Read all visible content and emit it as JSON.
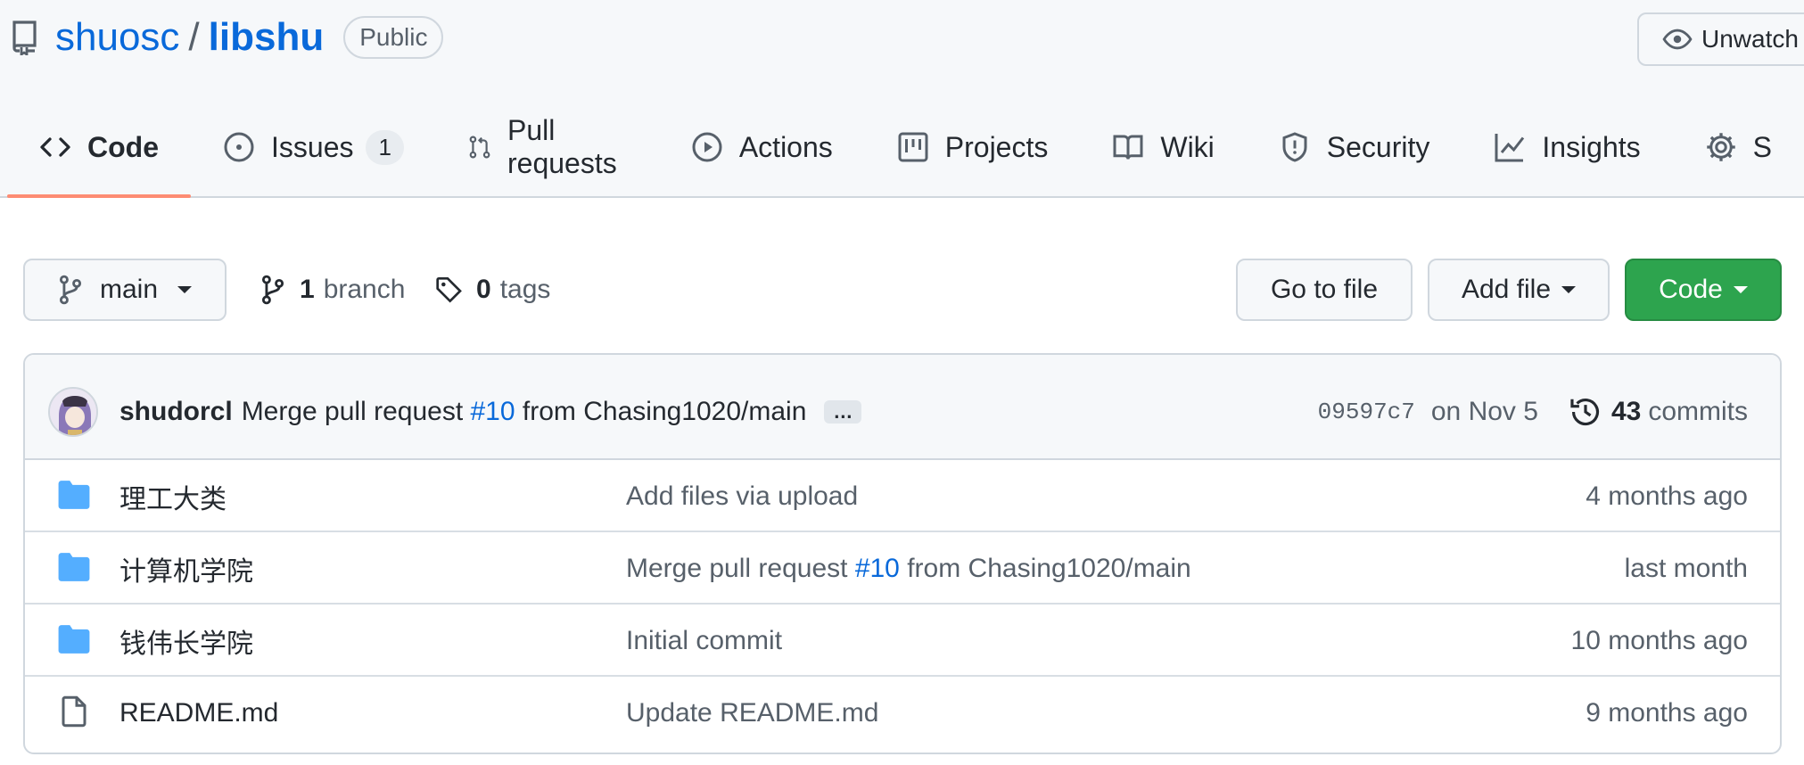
{
  "repo": {
    "owner": "shuosc",
    "separator": "/",
    "name": "libshu",
    "visibility": "Public"
  },
  "header_actions": {
    "watch_label": "Unwatch"
  },
  "tabs": [
    {
      "label": "Code",
      "icon": "code-icon",
      "selected": true
    },
    {
      "label": "Issues",
      "icon": "issue-icon",
      "count": "1"
    },
    {
      "label": "Pull requests",
      "icon": "pull-request-icon"
    },
    {
      "label": "Actions",
      "icon": "play-icon"
    },
    {
      "label": "Projects",
      "icon": "project-icon"
    },
    {
      "label": "Wiki",
      "icon": "book-icon"
    },
    {
      "label": "Security",
      "icon": "shield-icon"
    },
    {
      "label": "Insights",
      "icon": "graph-icon"
    },
    {
      "label": "S",
      "icon": "gear-icon"
    }
  ],
  "branch_bar": {
    "branch": "main",
    "branch_count": "1",
    "branch_word": "branch",
    "tag_count": "0",
    "tag_word": "tags",
    "go_to_file": "Go to file",
    "add_file": "Add file",
    "code": "Code"
  },
  "latest_commit": {
    "author": "shudorcl",
    "message_prefix": "Merge pull request",
    "pr": "#10",
    "message_suffix": "from Chasing1020/main",
    "ellipsis": "…",
    "sha": "09597c7",
    "date": "on Nov 5",
    "commit_count": "43",
    "commit_word": "commits"
  },
  "files": [
    {
      "type": "directory",
      "name": "理工大类",
      "commit": "Add files via upload",
      "age": "4 months ago"
    },
    {
      "type": "directory",
      "name": "计算机学院",
      "commit_prefix": "Merge pull request",
      "commit_pr": "#10",
      "commit_suffix": "from Chasing1020/main",
      "age": "last month"
    },
    {
      "type": "directory",
      "name": "钱伟长学院",
      "commit": "Initial commit",
      "age": "10 months ago"
    },
    {
      "type": "file",
      "name": "README.md",
      "commit": "Update README.md",
      "age": "9 months ago"
    }
  ],
  "colors": {
    "link": "#0969da",
    "accent_underline": "#fd8c73",
    "green_button": "#2da44e",
    "folder": "#54aeff"
  }
}
